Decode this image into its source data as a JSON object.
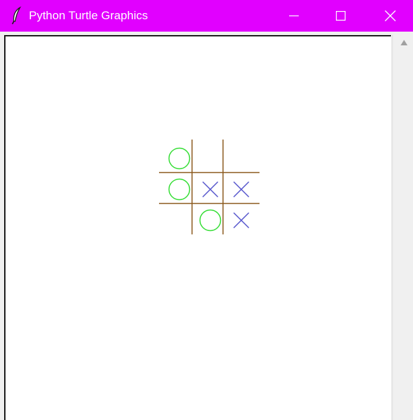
{
  "window": {
    "title": "Python Turtle Graphics",
    "titlebar_color": "#e100ff",
    "icon": "feather-icon",
    "controls": [
      "minimize-icon",
      "maximize-icon",
      "close-icon"
    ]
  },
  "board": {
    "grid_color": "#8b5a1e",
    "o_color": "#33dd33",
    "x_color": "#5555cc",
    "cells": [
      [
        "O",
        "",
        ""
      ],
      [
        "O",
        "X",
        "X"
      ],
      [
        "",
        "O",
        "X"
      ]
    ]
  },
  "scrollbar": {
    "up_arrow_icon": "scroll-up-arrow-icon"
  }
}
